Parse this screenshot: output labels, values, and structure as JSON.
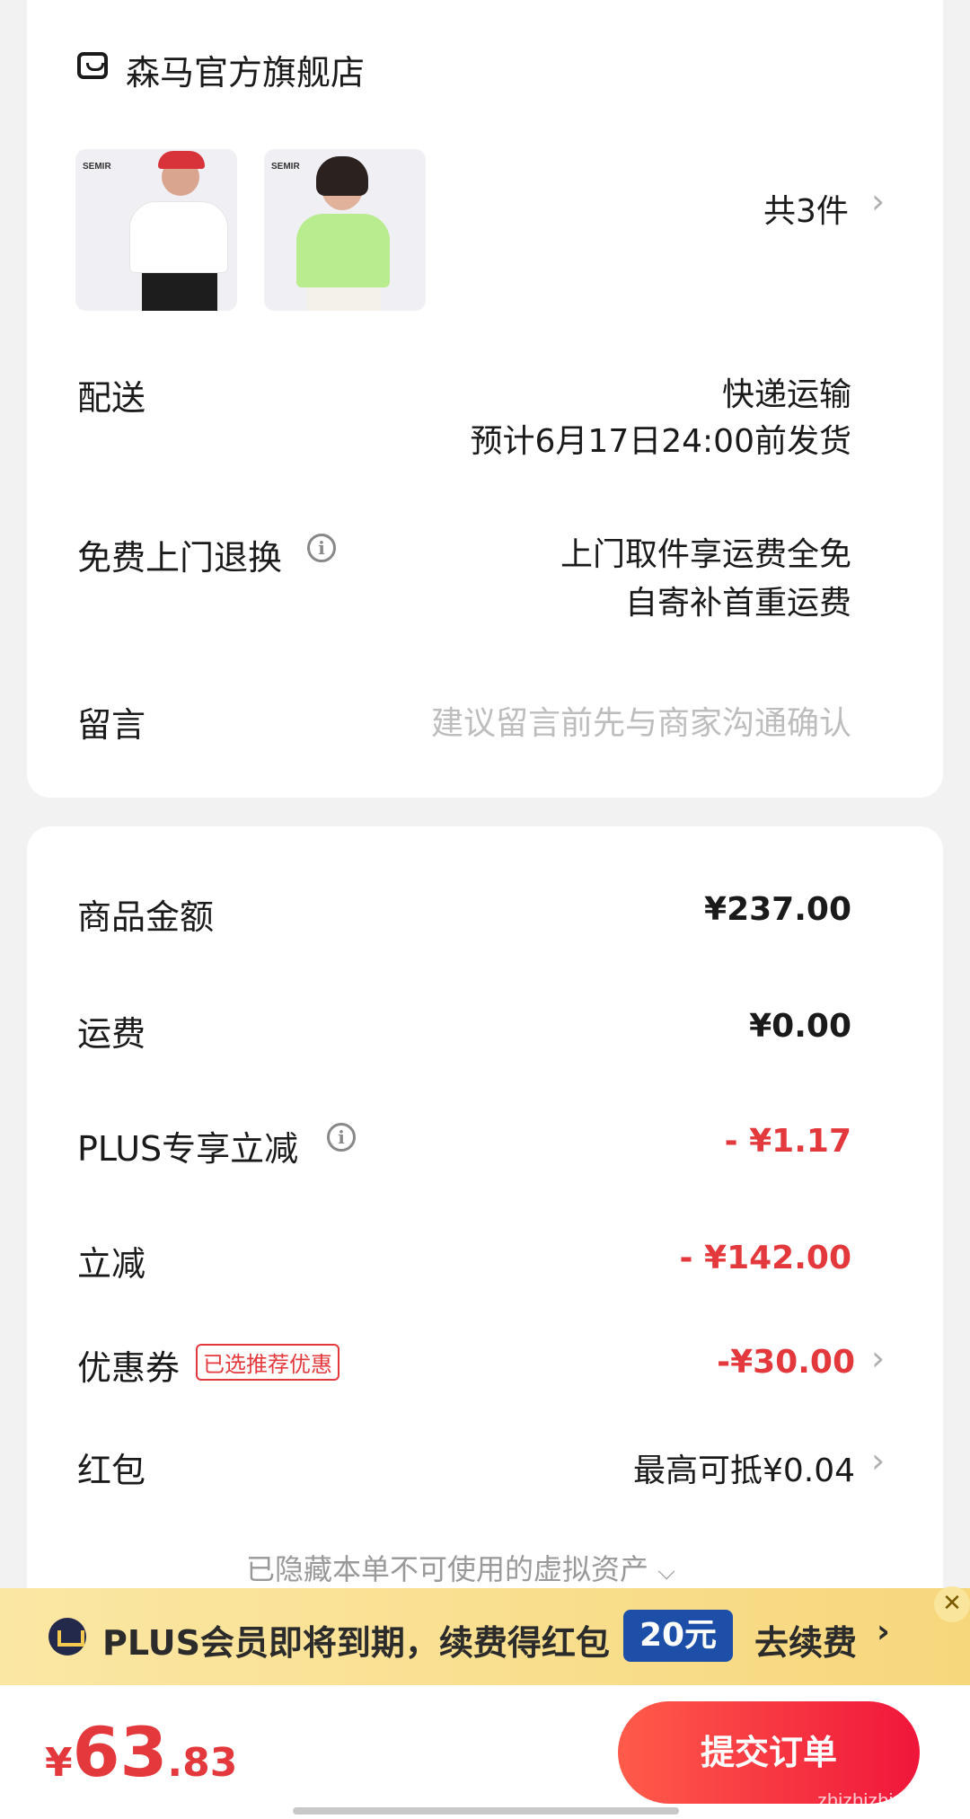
{
  "store": {
    "name": "森马官方旗舰店",
    "brand_mark": "SEMIR",
    "item_count": "共3件"
  },
  "delivery": {
    "label": "配送",
    "method": "快递运输",
    "estimate": "预计6月17日24:00前发货"
  },
  "returns": {
    "label": "免费上门退换",
    "line1": "上门取件享运费全免",
    "line2": "自寄补首重运费"
  },
  "message": {
    "label": "留言",
    "placeholder": "建议留言前先与商家沟通确认"
  },
  "price": {
    "goods_label": "商品金额",
    "goods_value": "¥237.00",
    "shipping_label": "运费",
    "shipping_value": "¥0.00",
    "plus_label": "PLUS专享立减",
    "plus_value": "- ¥1.17",
    "instant_label": "立减",
    "instant_value": "- ¥142.00",
    "coupon_label": "优惠券",
    "coupon_tag": "已选推荐优惠",
    "coupon_value": "-¥30.00",
    "redpack_label": "红包",
    "redpack_value": "最高可抵¥0.04",
    "hidden_note": "已隐藏本单不可使用的虚拟资产"
  },
  "plus_banner": {
    "text": "PLUS会员即将到期，续费得红包",
    "amount": "20元",
    "action": "去续费",
    "close": "✕"
  },
  "bottom": {
    "yen": "¥",
    "total_int": "63",
    "total_dec": ".83",
    "submit": "提交订单",
    "watermark": "zhizhizhi.com"
  },
  "colors": {
    "accent_red": "#e4393c",
    "plus_gold": "#f7d77c",
    "plus_blue": "#1e4fa8"
  }
}
